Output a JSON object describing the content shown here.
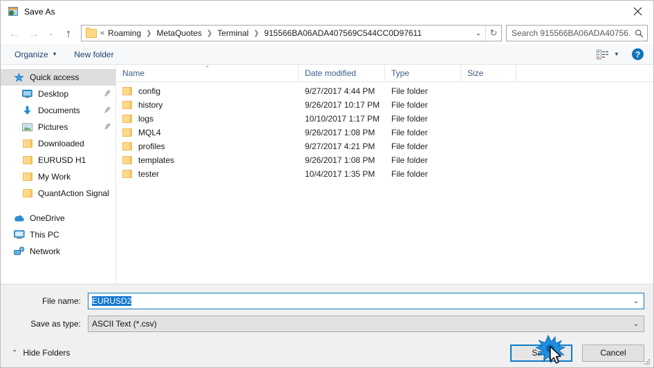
{
  "window": {
    "title": "Save As",
    "title_icon": "save-as-app-icon",
    "close_label": "✕"
  },
  "navigation": {
    "back_icon": "back-arrow-icon",
    "forward_icon": "forward-arrow-icon",
    "recent_icon": "chevron-down-icon",
    "up_icon": "up-arrow-icon",
    "back_glyph": "←",
    "forward_glyph": "→",
    "up_glyph": "↑",
    "chevron_glyph": "⌄",
    "refresh_glyph": "↻"
  },
  "address": {
    "folder_icon": "folder-icon",
    "lead": "«",
    "crumbs": [
      "Roaming",
      "MetaQuotes",
      "Terminal",
      "915566BA06ADA407569C544CC0D97611"
    ],
    "separator": "❯"
  },
  "search": {
    "placeholder": "Search 915566BA06ADA40756...",
    "icon": "search-icon"
  },
  "toolbar": {
    "organize_label": "Organize",
    "organize_caret": "▾",
    "new_folder_label": "New folder",
    "view_icon": "view-layout-icon",
    "view_caret": "▾",
    "help_label": "?",
    "help_icon": "help-icon"
  },
  "sidebar": {
    "items": [
      {
        "label": "Quick access",
        "icon": "star-icon",
        "selected": true,
        "indent": false,
        "pinned": false
      },
      {
        "label": "Desktop",
        "icon": "desktop-icon",
        "selected": false,
        "indent": true,
        "pinned": true
      },
      {
        "label": "Documents",
        "icon": "documents-icon",
        "selected": false,
        "indent": true,
        "pinned": true
      },
      {
        "label": "Pictures",
        "icon": "pictures-icon",
        "selected": false,
        "indent": true,
        "pinned": true
      },
      {
        "label": "Downloaded",
        "icon": "folder-icon",
        "selected": false,
        "indent": true,
        "pinned": false
      },
      {
        "label": "EURUSD H1",
        "icon": "folder-icon",
        "selected": false,
        "indent": true,
        "pinned": false
      },
      {
        "label": "My Work",
        "icon": "folder-icon",
        "selected": false,
        "indent": true,
        "pinned": false
      },
      {
        "label": "QuantAction Signal",
        "icon": "folder-icon",
        "selected": false,
        "indent": true,
        "pinned": false
      }
    ],
    "groups": [
      {
        "label": "OneDrive",
        "icon": "onedrive-cloud-icon"
      },
      {
        "label": "This PC",
        "icon": "this-pc-icon"
      },
      {
        "label": "Network",
        "icon": "network-icon"
      }
    ]
  },
  "file_list": {
    "columns": [
      "Name",
      "Date modified",
      "Type",
      "Size"
    ],
    "sort_column": "Name",
    "sort_caret": "⌃",
    "rows": [
      {
        "name": "config",
        "date": "9/27/2017 4:44 PM",
        "type": "File folder",
        "size": ""
      },
      {
        "name": "history",
        "date": "9/26/2017 10:17 PM",
        "type": "File folder",
        "size": ""
      },
      {
        "name": "logs",
        "date": "10/10/2017 1:17 PM",
        "type": "File folder",
        "size": ""
      },
      {
        "name": "MQL4",
        "date": "9/26/2017 1:08 PM",
        "type": "File folder",
        "size": ""
      },
      {
        "name": "profiles",
        "date": "9/27/2017 4:21 PM",
        "type": "File folder",
        "size": ""
      },
      {
        "name": "templates",
        "date": "9/26/2017 1:08 PM",
        "type": "File folder",
        "size": ""
      },
      {
        "name": "tester",
        "date": "10/4/2017 1:35 PM",
        "type": "File folder",
        "size": ""
      }
    ]
  },
  "footer": {
    "file_name_label": "File name:",
    "file_name_value": "EURUSD2",
    "file_type_label": "Save as type:",
    "file_type_value": "ASCII Text (*.csv)",
    "combo_chevron": "⌄",
    "hide_folders_label": "Hide Folders",
    "hide_folders_caret": "⌃",
    "save_label": "Save",
    "cancel_label": "Cancel"
  },
  "colors": {
    "accent": "#0a7bc4",
    "selection": "#1477d2",
    "toolbar_text": "#1c3f6e",
    "folder": "#fdd98a",
    "help_blue": "#1073bc"
  },
  "cursor": {
    "icon": "mouse-pointer-icon",
    "effect": "click-burst"
  }
}
